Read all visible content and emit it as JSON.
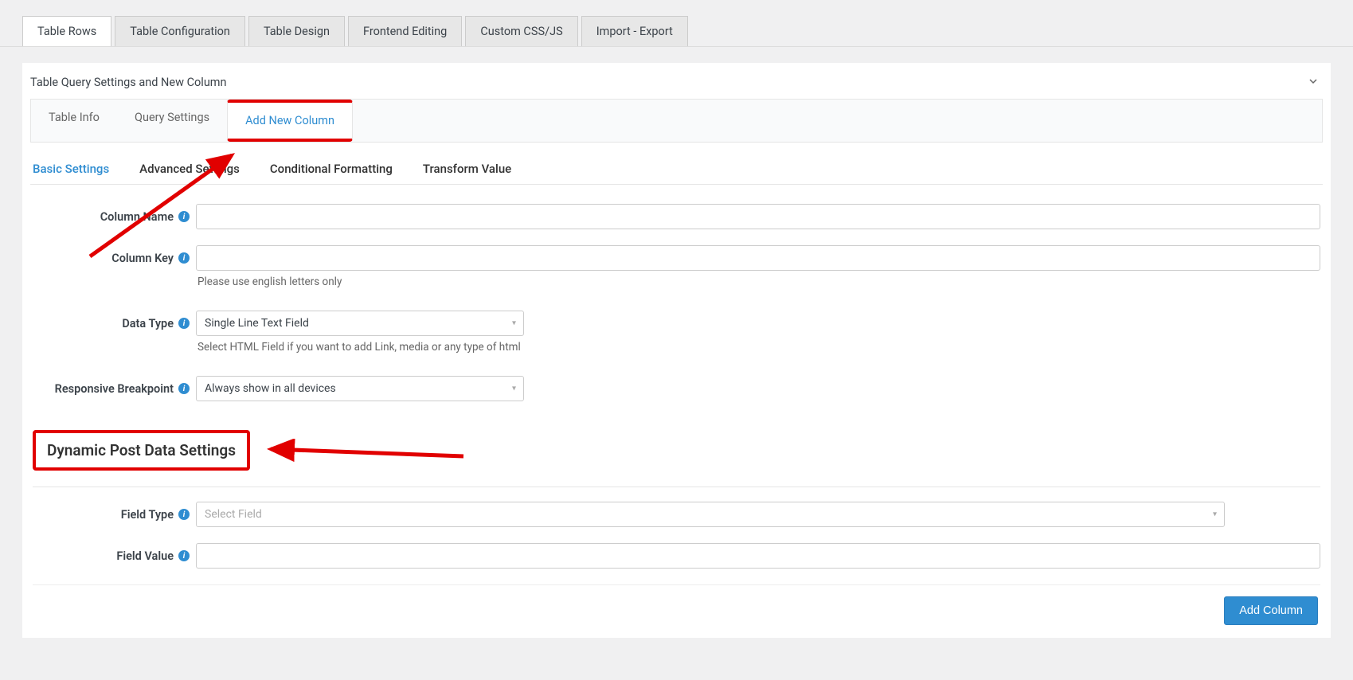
{
  "main_tabs": {
    "table_rows": "Table Rows",
    "table_configuration": "Table Configuration",
    "table_design": "Table Design",
    "frontend_editing": "Frontend Editing",
    "custom_css_js": "Custom CSS/JS",
    "import_export": "Import - Export"
  },
  "panel": {
    "title": "Table Query Settings and New Column"
  },
  "inner_tabs": {
    "table_info": "Table Info",
    "query_settings": "Query Settings",
    "add_new_column": "Add New Column"
  },
  "sub_tabs": {
    "basic_settings": "Basic Settings",
    "advanced_settings": "Advanced Settings",
    "conditional_formatting": "Conditional Formatting",
    "transform_value": "Transform Value"
  },
  "form": {
    "column_name": {
      "label": "Column Name",
      "value": ""
    },
    "column_key": {
      "label": "Column Key",
      "value": "",
      "helper": "Please use english letters only"
    },
    "data_type": {
      "label": "Data Type",
      "value": "Single Line Text Field",
      "helper": "Select HTML Field if you want to add Link, media or any type of html"
    },
    "responsive_breakpoint": {
      "label": "Responsive Breakpoint",
      "value": "Always show in all devices"
    }
  },
  "dynamic_section": {
    "title": "Dynamic Post Data Settings",
    "field_type": {
      "label": "Field Type",
      "placeholder": "Select Field",
      "value": ""
    },
    "field_value": {
      "label": "Field Value",
      "value": ""
    }
  },
  "footer": {
    "add_column": "Add Column"
  }
}
